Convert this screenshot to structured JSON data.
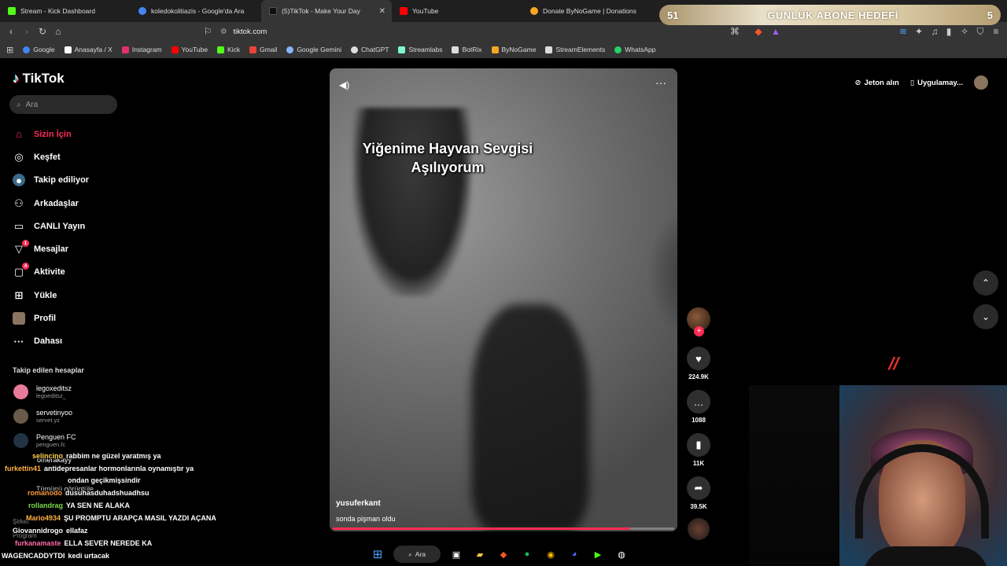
{
  "browser": {
    "tabs": [
      {
        "label": "Stream - Kick Dashboard",
        "color": "#53fc18"
      },
      {
        "label": "koledokolitiazis - Google'da Ara",
        "color": "#4285f4"
      },
      {
        "label": "(5)TikTok - Make Your Day",
        "color": "#111111",
        "active": true
      },
      {
        "label": "YouTube",
        "color": "#ff0000"
      },
      {
        "label": "Donate ByNoGame | Donations",
        "color": "#f5a623"
      }
    ],
    "url": "tiktok.com",
    "bookmarks": [
      {
        "label": "Google",
        "color": "#4285f4"
      },
      {
        "label": "Anasayfa / X",
        "color": "#ffffff"
      },
      {
        "label": "Instagram",
        "color": "#e1306c"
      },
      {
        "label": "YouTube",
        "color": "#ff0000"
      },
      {
        "label": "Kick",
        "color": "#53fc18"
      },
      {
        "label": "Gmail",
        "color": "#ea4335"
      },
      {
        "label": "Google Gemini",
        "color": "#8ab4f8"
      },
      {
        "label": "ChatGPT",
        "color": "#dddddd"
      },
      {
        "label": "Streamlabs",
        "color": "#80f5d2"
      },
      {
        "label": "BotRix",
        "color": "#dddddd"
      },
      {
        "label": "ByNoGame",
        "color": "#f5a623"
      },
      {
        "label": "StreamElements",
        "color": "#dddddd"
      },
      {
        "label": "WhatsApp",
        "color": "#25d366"
      }
    ]
  },
  "goal_overlay": {
    "left": "51",
    "title": "GÜNLÜK ABONE HEDEFİ",
    "right": "5"
  },
  "tiktok": {
    "logo": "TikTok",
    "search_placeholder": "Ara",
    "nav": [
      {
        "label": "Sizin İçin",
        "icon": "home-icon",
        "active": true
      },
      {
        "label": "Keşfet",
        "icon": "compass-icon"
      },
      {
        "label": "Takip ediliyor",
        "icon": "following-icon"
      },
      {
        "label": "Arkadaşlar",
        "icon": "friends-icon"
      },
      {
        "label": "CANLI Yayın",
        "icon": "live-icon"
      },
      {
        "label": "Mesajlar",
        "icon": "messages-icon",
        "badge": "1"
      },
      {
        "label": "Aktivite",
        "icon": "activity-icon",
        "badge": "4"
      },
      {
        "label": "Yükle",
        "icon": "upload-icon"
      },
      {
        "label": "Profil",
        "icon": "profile-icon"
      },
      {
        "label": "Dahası",
        "icon": "more-icon"
      }
    ],
    "following_title": "Takip edilen hesaplar",
    "following": [
      {
        "name": "legoxeditsz",
        "handle": "legoeditsz_"
      },
      {
        "name": "servetinyoo",
        "handle": "servet.yz"
      },
      {
        "name": "Penguen FC",
        "handle": "penguen.fc"
      },
      {
        "name": "omerakayy",
        "handle": ""
      }
    ],
    "see_all": "Tümünü görüntüle",
    "company": "Şirket",
    "program": "Program",
    "top_right": {
      "coins": "Jeton alın",
      "app": "Uygulamay..."
    },
    "video": {
      "overlay_line1": "Yiğenime Hayvan Sevgisi",
      "overlay_line2": "Aşılıyorum",
      "author": "yusuferkant",
      "description": "sonda pişman oldu",
      "progress": 0.87
    },
    "actions": {
      "likes": "224.9K",
      "comments": "1088",
      "saves": "11K",
      "shares": "39.5K"
    }
  },
  "chat": [
    {
      "user": "selincino",
      "text": "rabbim ne güzel yaratmış ya",
      "color": "#ffd24a"
    },
    {
      "user": "furkettin41",
      "text": "antidepresanlar hormonlarınla oynamıştır ya",
      "color": "#ffb347"
    },
    {
      "user": "",
      "text": "ondan geçikmişsindir",
      "color": "#ffffff"
    },
    {
      "user": "romanodo",
      "text": "dusuhasduhadshuadhsu",
      "color": "#ff9a3c"
    },
    {
      "user": "rollandrag",
      "text": "YA SEN NE ALAKA",
      "color": "#7fdc4a"
    },
    {
      "user": "Mario4934",
      "text": "ŞU PROMPTU ARAPÇA MASIL YAZDI AÇANA",
      "color": "#ffb347"
    },
    {
      "user": "Giovannidrogo",
      "text": "ellafaz",
      "color": "#ffffff"
    },
    {
      "user": "furkanamaste",
      "text": "ELLA SEVER NEREDE KA",
      "color": "#ff6ba8"
    },
    {
      "user": "WAGENCADDYTDI",
      "text": "kedi urtacak",
      "color": "#ffffff"
    }
  ],
  "taskbar": {
    "search_label": "Ara"
  }
}
